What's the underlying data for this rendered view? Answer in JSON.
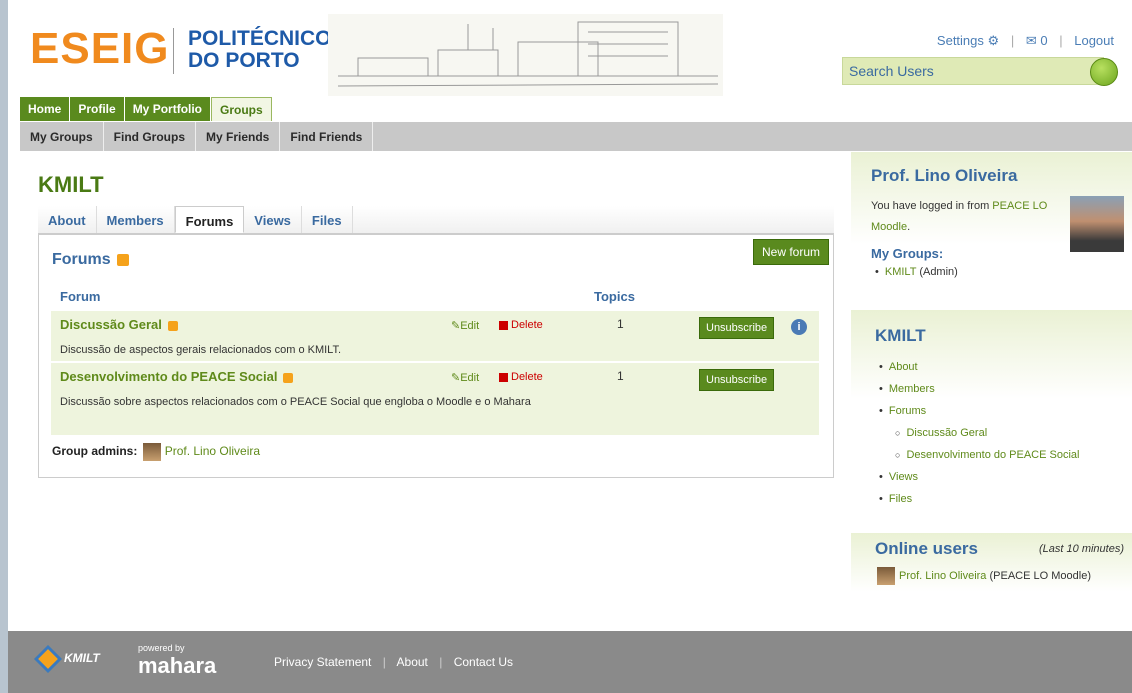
{
  "header": {
    "logo_main": "ESEIG",
    "logo_sub_line1": "POLITÉCNICO",
    "logo_sub_line2": "DO PORTO",
    "settings": "Settings",
    "messages_count": "0",
    "logout": "Logout",
    "search_placeholder": "Search Users"
  },
  "nav_main": [
    "Home",
    "Profile",
    "My Portfolio",
    "Groups"
  ],
  "nav_sub": [
    "My Groups",
    "Find Groups",
    "My Friends",
    "Find Friends"
  ],
  "group": {
    "title": "KMILT",
    "tabs": [
      "About",
      "Members",
      "Forums",
      "Views",
      "Files"
    ],
    "active_tab": "Forums"
  },
  "forums": {
    "heading": "Forums",
    "new_forum_label": "New forum",
    "col_forum": "Forum",
    "col_topics": "Topics",
    "edit_label": "Edit",
    "delete_label": "Delete",
    "unsubscribe_label": "Unsubscribe",
    "rows": [
      {
        "title": "Discussão Geral",
        "description": "Discussão de aspectos gerais relacionados com o KMILT.",
        "topics": "1"
      },
      {
        "title": "Desenvolvimento do PEACE Social",
        "description": "Discussão sobre aspectos relacionados com o PEACE Social que engloba o Moodle e o Mahara",
        "topics": "1"
      }
    ],
    "admins_label": "Group admins:",
    "admin_name": "Prof. Lino Oliveira"
  },
  "sidebar": {
    "profile_name": "Prof. Lino Oliveira",
    "login_text": "You have logged in from",
    "login_link": "PEACE LO Moodle",
    "my_groups_label": "My Groups:",
    "my_group_link": "KMILT",
    "my_group_role": "(Admin)",
    "group_block_title": "KMILT",
    "group_links": [
      "About",
      "Members",
      "Forums",
      "Views",
      "Files"
    ],
    "forum_links": [
      "Discussão Geral",
      "Desenvolvimento do PEACE Social"
    ],
    "online_title": "Online users",
    "online_period": "(Last 10 minutes)",
    "online_user": "Prof. Lino Oliveira",
    "online_user_source": "(PEACE LO Moodle)"
  },
  "footer": {
    "kmilt": "KMILT",
    "powered_by": "powered by",
    "mahara": "mahara",
    "links": [
      "Privacy Statement",
      "About",
      "Contact Us"
    ]
  }
}
